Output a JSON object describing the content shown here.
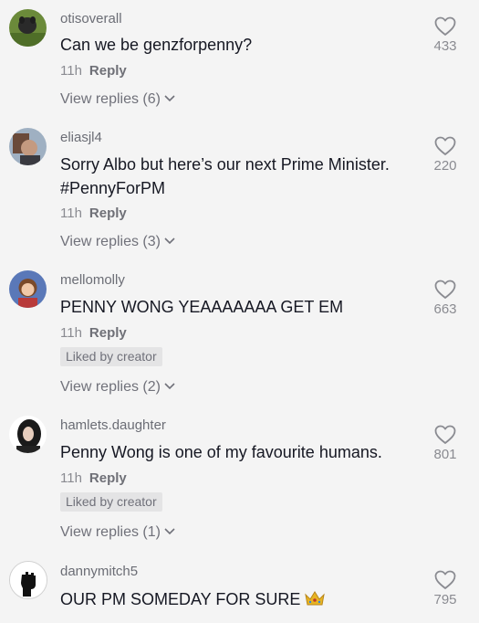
{
  "comments": [
    {
      "username": "otisoverall",
      "text": "Can we be genzforpenny?",
      "time": "11h",
      "reply_label": "Reply",
      "liked_by_creator": "",
      "view_replies": "View replies (6)",
      "likes": "433"
    },
    {
      "username": "eliasjl4",
      "text": "Sorry Albo but here’s our next Prime Minister. #PennyForPM",
      "time": "11h",
      "reply_label": "Reply",
      "liked_by_creator": "",
      "view_replies": "View replies (3)",
      "likes": "220"
    },
    {
      "username": "mellomolly",
      "text": "PENNY WONG YEAAAAAAA GET EM",
      "time": "11h",
      "reply_label": "Reply",
      "liked_by_creator": "Liked by creator",
      "view_replies": "View replies (2)",
      "likes": "663"
    },
    {
      "username": "hamlets.daughter",
      "text": "Penny Wong is one of my favourite humans.",
      "time": "11h",
      "reply_label": "Reply",
      "liked_by_creator": "Liked by creator",
      "view_replies": "View replies (1)",
      "likes": "801"
    },
    {
      "username": "dannymitch5",
      "text": "OUR PM SOMEDAY FOR SURE",
      "emoji": "crown-icon",
      "likes": "795"
    }
  ],
  "colors": {
    "background": "#f4f4f4",
    "primary_text": "#161823",
    "secondary_text": "#8a8b91",
    "badge_bg": "#e4e4e5"
  }
}
